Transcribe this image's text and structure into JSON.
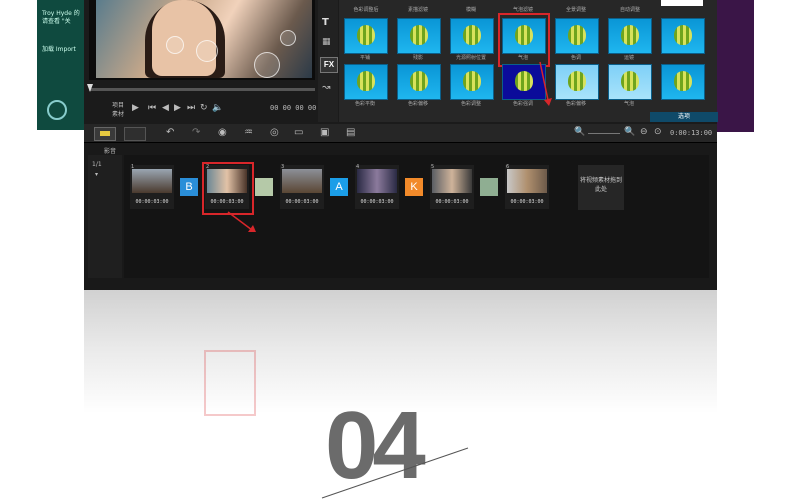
{
  "teal_panel": {
    "line1": "Troy Hyde 的",
    "line2": "请查看 \"关",
    "line3": "加载 Import"
  },
  "player": {
    "mode_labels": [
      "项目",
      "素材"
    ],
    "timecode": "00 00 00 00"
  },
  "tools": {
    "fx": "FX",
    "title_tool": "T"
  },
  "library": {
    "row1_labels": [
      "色彩调整后",
      "素描滤镜",
      "模糊",
      "气泡滤镜",
      "全景调整",
      "自动调整"
    ],
    "row2_labels": [
      "平铺",
      "残影",
      "光源照射位置",
      "气泡",
      "色调",
      "运镜"
    ],
    "row3_labels": [
      "色彩平衡",
      "色彩偏移",
      "色彩调整",
      "色彩强调",
      "色彩偏移",
      "气泡"
    ],
    "footer": "选项"
  },
  "timeline": {
    "zoom_time": "0:00:13:00",
    "track_label": "影音",
    "clips": [
      {
        "num": "1",
        "time": "00:00:03:00"
      },
      {
        "num": "2",
        "time": "00:00:03:00"
      },
      {
        "num": "3",
        "time": "00:00:03:00"
      },
      {
        "num": "4",
        "time": "00:00:03:00"
      },
      {
        "num": "5",
        "time": "00:00:03:00"
      },
      {
        "num": "6",
        "time": "00:00:03:00"
      }
    ],
    "transitions": [
      "B",
      "",
      "A",
      "K",
      ""
    ],
    "drop_hint": "将视频素材拖到此处"
  },
  "step_number": "04",
  "colors": {
    "highlight": "#d8262a",
    "accent_blue": "#1fb6ef"
  }
}
